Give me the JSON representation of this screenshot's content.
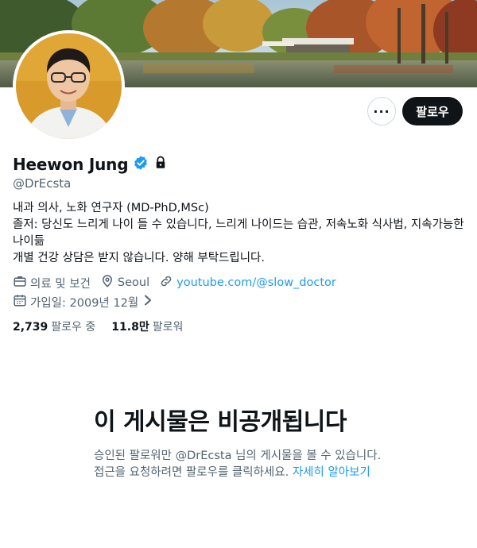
{
  "profile": {
    "display_name": "Heewon Jung",
    "handle": "@DrEcsta",
    "bio_lines": [
      "내과 의사, 노화 연구자 (MD-PhD,MSc)",
      "졸저: 당신도 느리게 나이 들 수 있습니다, 느리게 나이드는 습관, 저속노화 식사법, 지속가능한 나이듦",
      "개별 건강 상담은 받지 않습니다. 양해 부탁드립니다."
    ],
    "category": "의료 및 보건",
    "location": "Seoul",
    "website": "youtube.com/@slow_doctor",
    "joined": "가입일: 2009년 12월",
    "verified_icon": "verified-badge-icon",
    "protected_icon": "lock-icon"
  },
  "stats": {
    "following_count": "2,739",
    "following_label": "팔로우 중",
    "followers_count": "11.8만",
    "followers_label": "팔로워"
  },
  "actions": {
    "more_label": "···",
    "follow_label": "팔로우"
  },
  "private_notice": {
    "title": "이 게시물은 비공개됩니다",
    "line1": "승인된 팔로워만 @DrEcsta 님의 게시물을 볼 수 있습니다.",
    "line2": "접근을 요청하려면 팔로우를 클릭하세요.",
    "learn_more": "자세히 알아보기"
  },
  "colors": {
    "accent": "#1d9bf0",
    "text_primary": "#0f1419",
    "text_secondary": "#536471",
    "button_dark": "#0f1419"
  }
}
